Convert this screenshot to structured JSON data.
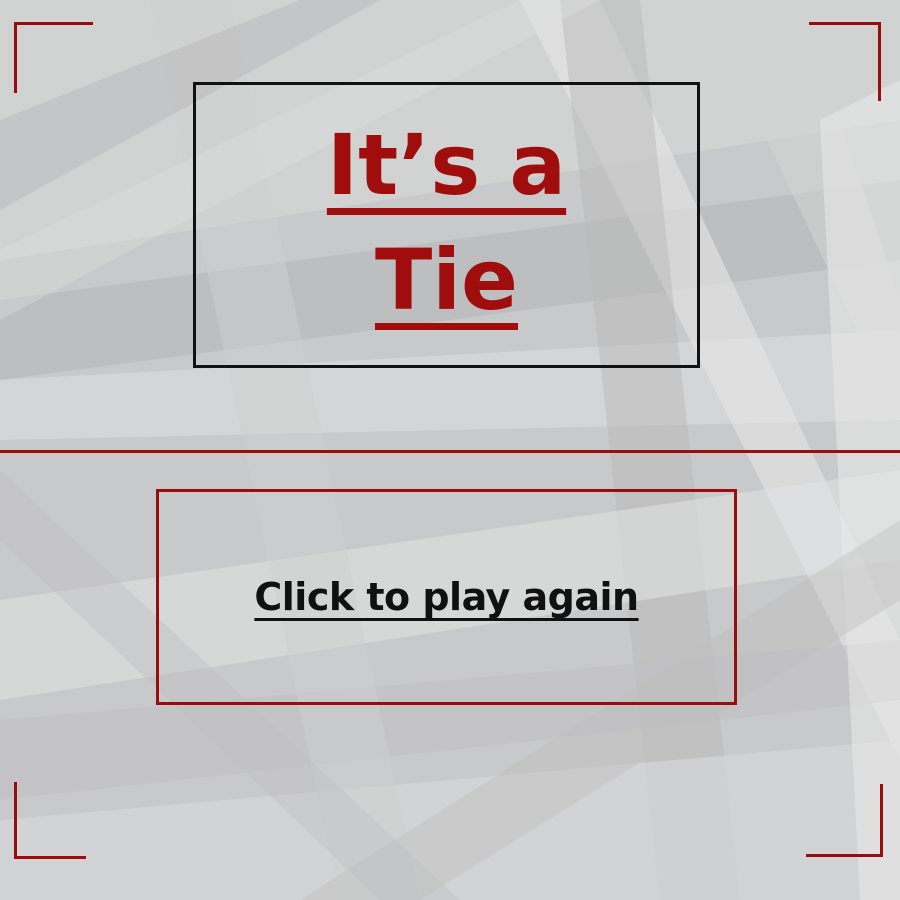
{
  "result": {
    "title": "It’s a Tie"
  },
  "play_again": {
    "label": "Click to play again"
  },
  "colors": {
    "accent": "#a00d0d",
    "frame_dark": "#111111",
    "background": "#c9cacb"
  }
}
